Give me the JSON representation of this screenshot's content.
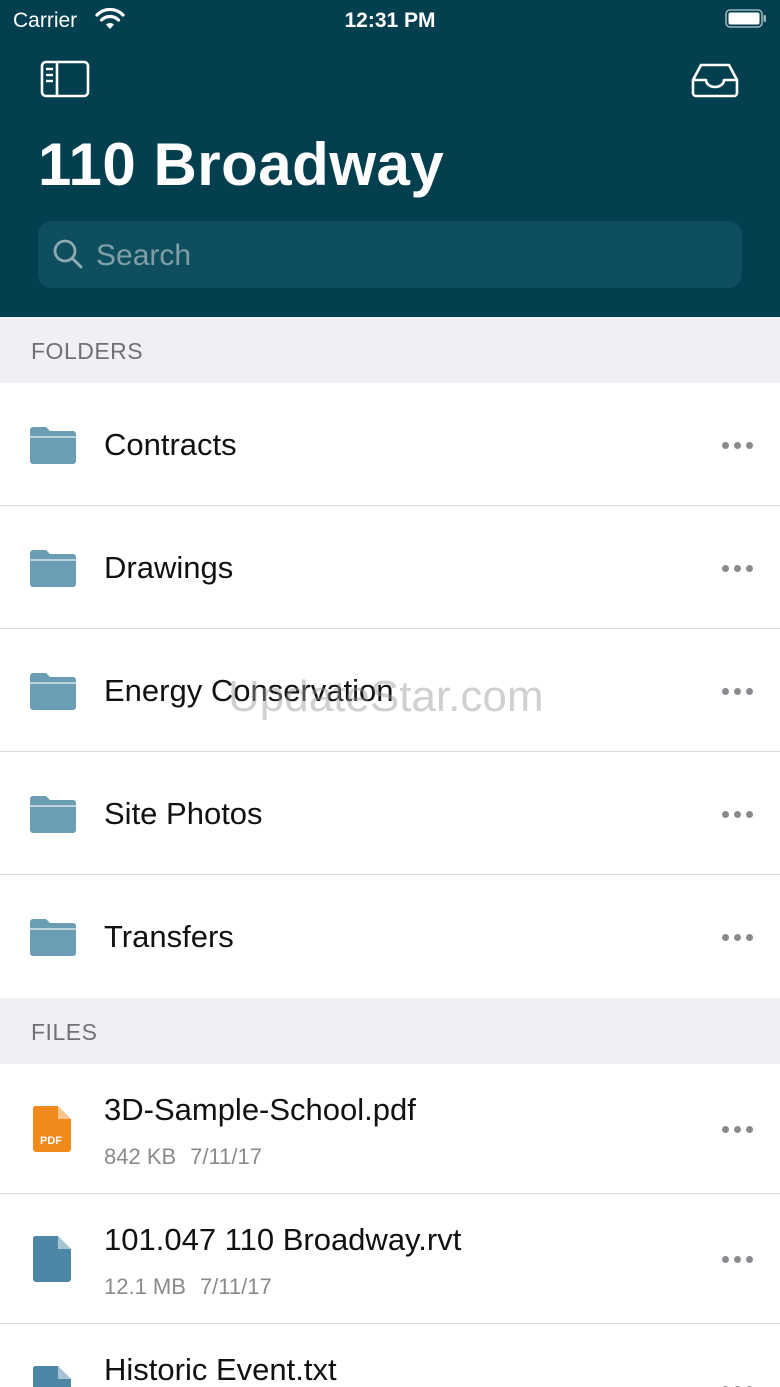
{
  "status_bar": {
    "carrier": "Carrier",
    "time": "12:31 PM"
  },
  "header": {
    "title": "110 Broadway",
    "search_placeholder": "Search",
    "left_icon": "sidebar-icon",
    "right_icon": "inbox-tray-icon",
    "background_color": "#043f4f"
  },
  "folders_section": {
    "label": "FOLDERS",
    "items": [
      {
        "name": "Contracts"
      },
      {
        "name": "Drawings"
      },
      {
        "name": "Energy Conservation"
      },
      {
        "name": "Site Photos"
      },
      {
        "name": "Transfers"
      }
    ],
    "folder_icon_color": "#6b9db5"
  },
  "files_section": {
    "label": "FILES",
    "items": [
      {
        "name": "3D-Sample-School.pdf",
        "size": "842 KB",
        "date": "7/11/17",
        "icon": "pdf-icon",
        "icon_label": "PDF",
        "icon_color": "#f08a1c"
      },
      {
        "name": "101.047 110 Broadway.rvt",
        "size": "12.1 MB",
        "date": "7/11/17",
        "icon": "document-icon",
        "icon_color": "#4e86a6"
      },
      {
        "name": "Historic Event.txt",
        "icon": "text-document-icon",
        "icon_color": "#4e86a6"
      }
    ]
  },
  "watermark": "UpdateStar.com"
}
